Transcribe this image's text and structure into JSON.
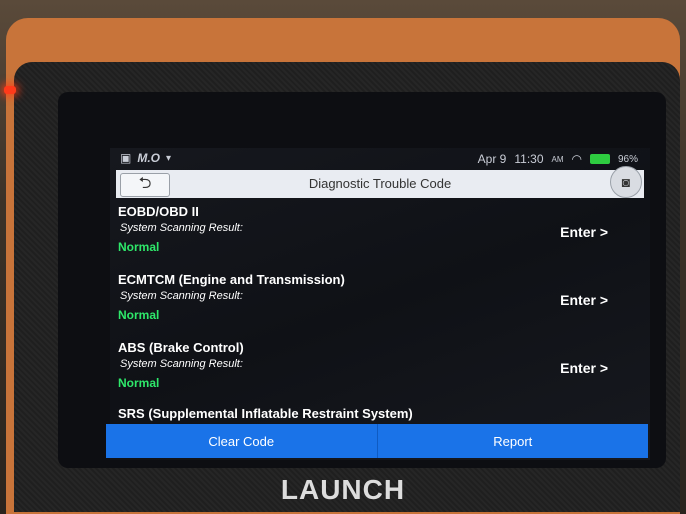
{
  "status_bar": {
    "app_label": "M.O",
    "date": "Apr 9",
    "time": "11:30",
    "ampm": "AM",
    "battery": "96%"
  },
  "header": {
    "title": "Diagnostic Trouble Code"
  },
  "systems": [
    {
      "name": "EOBD/OBD II",
      "subtitle": "System Scanning Result:",
      "status": "Normal",
      "action": "Enter >"
    },
    {
      "name": "ECMTCM (Engine and Transmission)",
      "subtitle": "System Scanning Result:",
      "status": "Normal",
      "action": "Enter >"
    },
    {
      "name": "ABS (Brake Control)",
      "subtitle": "System Scanning Result:",
      "status": "Normal",
      "action": "Enter >"
    },
    {
      "name": "SRS (Supplemental Inflatable Restraint System)",
      "subtitle": "",
      "status": "",
      "action": ""
    }
  ],
  "footer": {
    "clear_code": "Clear Code",
    "report": "Report"
  },
  "device": {
    "brand": "LAUNCH"
  }
}
